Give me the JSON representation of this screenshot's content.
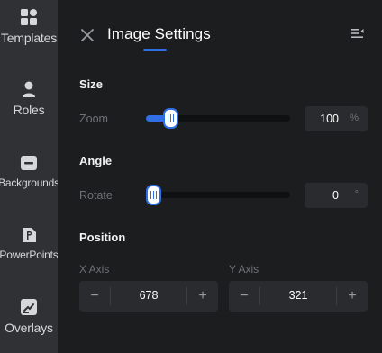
{
  "sidebar": {
    "items": [
      {
        "label": "Templates",
        "icon": "grid-icon"
      },
      {
        "label": "Roles",
        "icon": "person-icon"
      },
      {
        "label": "Backgrounds",
        "icon": "background-icon"
      },
      {
        "label": "PowerPoints",
        "icon": "powerpoint-file-icon"
      },
      {
        "label": "Overlays",
        "icon": "overlay-icon"
      }
    ]
  },
  "header": {
    "title": "Image Settings",
    "close_icon": "close-icon",
    "menu_icon": "list-collapse-icon"
  },
  "size": {
    "title": "Size",
    "zoom_label": "Zoom",
    "zoom_value": "100",
    "zoom_unit": "%",
    "zoom_level": 0.12
  },
  "angle": {
    "title": "Angle",
    "rotate_label": "Rotate",
    "rotate_value": "0",
    "rotate_unit": "°",
    "rotate_level": 0.0
  },
  "position": {
    "title": "Position",
    "x_label": "X Axis",
    "x_value": "678",
    "y_label": "Y Axis",
    "y_value": "321",
    "minus": "−",
    "plus": "+"
  },
  "colors": {
    "accent": "#2f6fe3",
    "sidebar_bg": "#303134",
    "panel_bg": "#1c1d1f",
    "field_bg": "#2a2b2e"
  }
}
